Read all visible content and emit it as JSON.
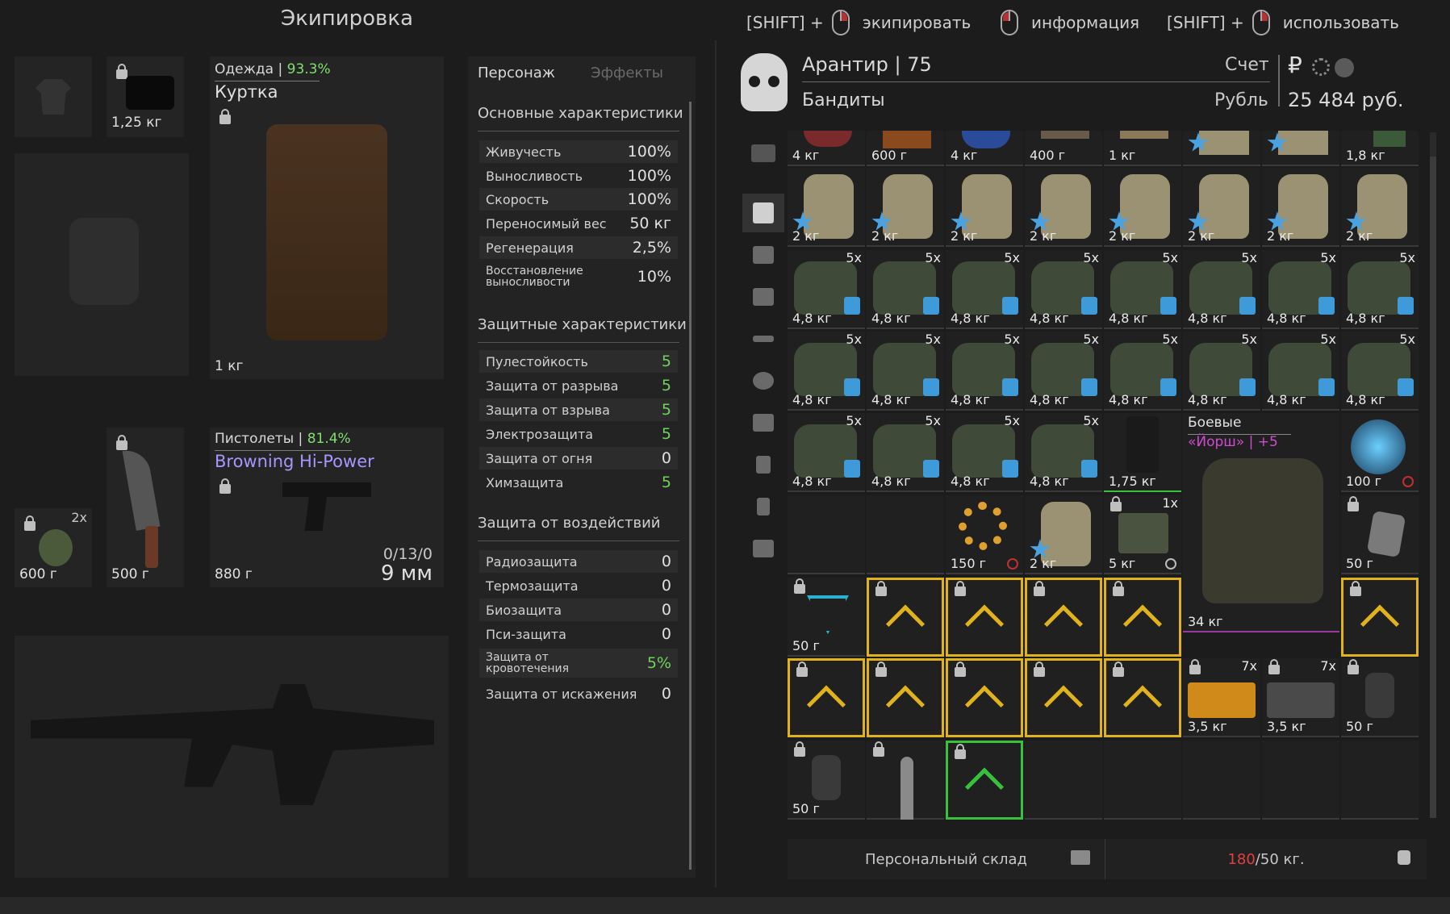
{
  "header": {
    "title": "Экипировка",
    "hints": [
      {
        "prefix": "[SHIFT] +",
        "label": "экипировать"
      },
      {
        "prefix": "",
        "label": "информация"
      },
      {
        "prefix": "[SHIFT] +",
        "label": "использовать"
      }
    ]
  },
  "equipment": {
    "top_small_weight": "1,25 кг",
    "clothing": {
      "category": "Одежда",
      "durability": "93.3%",
      "name": "Куртка",
      "weight": "1 кг"
    },
    "grenade": {
      "count": "2x",
      "weight": "600 г"
    },
    "knife": {
      "weight": "500 г"
    },
    "pistol": {
      "category": "Пистолеты",
      "durability": "81.4%",
      "name": "Browning Hi-Power",
      "weight": "880 г",
      "ammo": "0/13/0",
      "caliber": "9 мм"
    }
  },
  "stats": {
    "tabs": [
      "Персонаж",
      "Эффекты"
    ],
    "basic_title": "Основные характеристики",
    "basic": [
      {
        "label": "Живучесть",
        "value": "100%"
      },
      {
        "label": "Выносливость",
        "value": "100%"
      },
      {
        "label": "Скорость",
        "value": "100%"
      },
      {
        "label": "Переносимый вес",
        "value": "50 кг"
      },
      {
        "label": "Регенерация",
        "value": "2,5%"
      },
      {
        "label": "Восстановление выносливости",
        "value": "10%"
      }
    ],
    "protect_title": "Защитные характеристики",
    "protect": [
      {
        "label": "Пулестойкость",
        "value": "5"
      },
      {
        "label": "Защита от разрыва",
        "value": "5"
      },
      {
        "label": "Защита от взрыва",
        "value": "5"
      },
      {
        "label": "Электрозащита",
        "value": "5"
      },
      {
        "label": "Защита от огня",
        "value": "0"
      },
      {
        "label": "Химзащита",
        "value": "5"
      }
    ],
    "impact_title": "Защита от воздействий",
    "impact": [
      {
        "label": "Радиозащита",
        "value": "0"
      },
      {
        "label": "Термозащита",
        "value": "0"
      },
      {
        "label": "Биозащита",
        "value": "0"
      },
      {
        "label": "Пси-защита",
        "value": "0"
      },
      {
        "label": "Защита от кровотечения",
        "value": "5%"
      },
      {
        "label": "Защита от искажения",
        "value": "0"
      }
    ]
  },
  "profile": {
    "name": "Арантир",
    "level": "75",
    "faction": "Бандиты",
    "account_label": "Счет",
    "currency_label": "Рубль",
    "currency_symbol": "₽",
    "money": "25 484 руб."
  },
  "inventory": {
    "row0": [
      "4 кг",
      "600 г",
      "4 кг",
      "400 г",
      "1 кг",
      "",
      "",
      "1,8 кг"
    ],
    "plate_weight": "2 кг",
    "bag_count": "5x",
    "bag_weight": "4,8 кг",
    "misc": {
      "cylinder": "1,75 кг",
      "armor_title": "Боевые",
      "armor_name": "«Йорш» | +5",
      "armor_weight": "34 кг",
      "artifact": "100 г",
      "ring": "150 г",
      "plate": "2 кг",
      "ammo_box_count": "1x",
      "ammo_box": "5 кг",
      "tag": "50 г",
      "emblem": "50 г",
      "case_count": "7x",
      "case_orange": "3,5 кг",
      "case_gray": "3,5 кг",
      "figure1": "50 г",
      "figure2": "50 г"
    }
  },
  "storage": {
    "label": "Персональный склад",
    "current": "180",
    "max": "/50 кг."
  },
  "colors": {
    "accent_green": "#7fe06b",
    "locked_yellow": "#e0b21b",
    "pistol_name": "#a896ff",
    "armor_name": "#d04bd0",
    "over_weight": "#e04040"
  }
}
